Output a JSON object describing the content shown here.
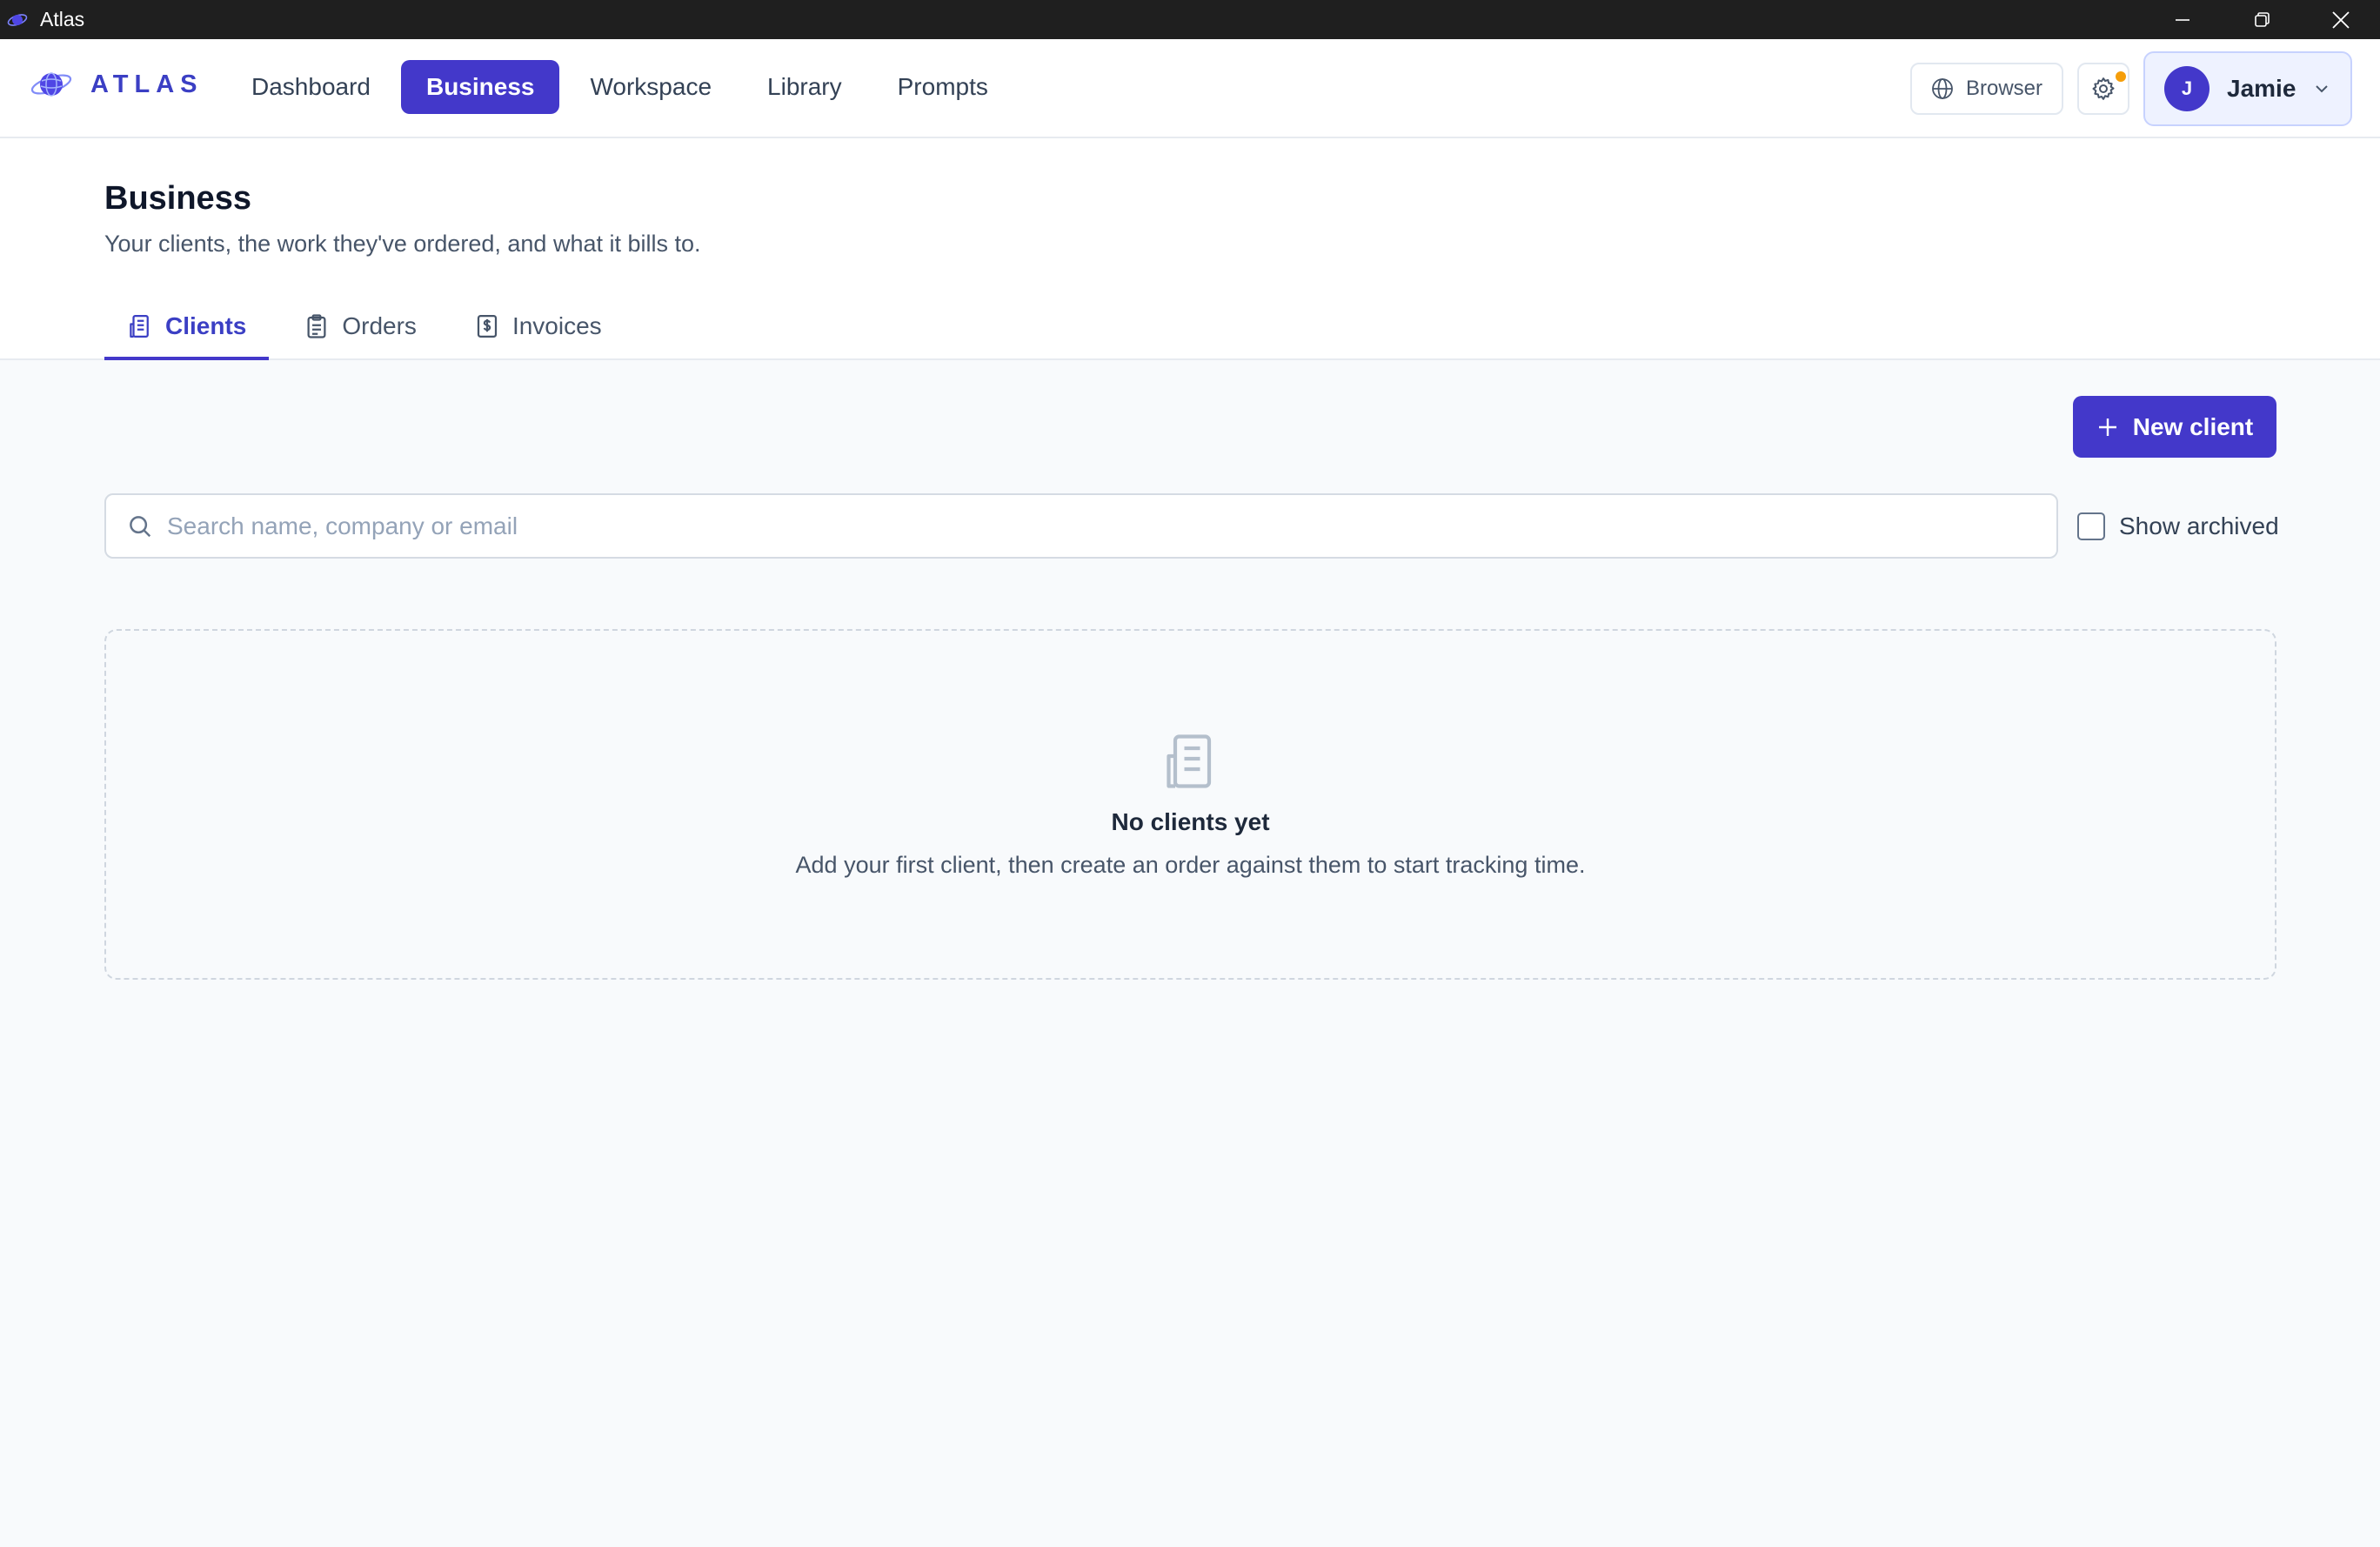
{
  "window": {
    "title": "Atlas"
  },
  "header": {
    "brand": "ATLAS",
    "nav": [
      {
        "label": "Dashboard",
        "active": false
      },
      {
        "label": "Business",
        "active": true
      },
      {
        "label": "Workspace",
        "active": false
      },
      {
        "label": "Library",
        "active": false
      },
      {
        "label": "Prompts",
        "active": false
      }
    ],
    "browser_label": "Browser",
    "user": {
      "initial": "J",
      "name": "Jamie"
    }
  },
  "page": {
    "title": "Business",
    "subtitle": "Your clients, the work they've ordered, and what it bills to.",
    "tabs": [
      {
        "label": "Clients",
        "icon": "building-icon",
        "active": true
      },
      {
        "label": "Orders",
        "icon": "clipboard-icon",
        "active": false
      },
      {
        "label": "Invoices",
        "icon": "invoice-icon",
        "active": false
      }
    ]
  },
  "toolbar": {
    "new_client_label": "New client",
    "search_placeholder": "Search name, company or email",
    "search_value": "",
    "show_archived_label": "Show archived",
    "show_archived_checked": false
  },
  "empty_state": {
    "icon": "building-icon",
    "title": "No clients yet",
    "description": "Add your first client, then create an order against them to start tracking time."
  },
  "colors": {
    "accent": "#4338ca",
    "brand_text": "#3b3fc4",
    "notification_dot": "#f59e0b",
    "titlebar": "#1f1f1f"
  }
}
